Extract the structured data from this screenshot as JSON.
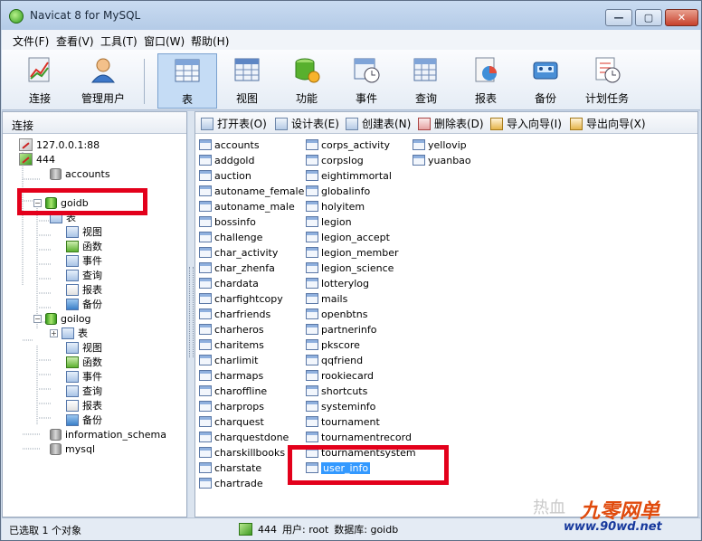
{
  "window": {
    "title": "Navicat 8 for MySQL",
    "min_glyph": "—",
    "max_glyph": "▢",
    "close_glyph": "✕"
  },
  "menu": [
    "文件(F)",
    "查看(V)",
    "工具(T)",
    "窗口(W)",
    "帮助(H)"
  ],
  "toolbar": [
    {
      "label": "连接",
      "icon": "connection-icon"
    },
    {
      "label": "管理用户",
      "icon": "user-icon"
    },
    {
      "label": "表",
      "icon": "table-icon",
      "active": true
    },
    {
      "label": "视图",
      "icon": "view-icon"
    },
    {
      "label": "功能",
      "icon": "function-icon"
    },
    {
      "label": "事件",
      "icon": "event-icon"
    },
    {
      "label": "查询",
      "icon": "query-icon"
    },
    {
      "label": "报表",
      "icon": "report-icon"
    },
    {
      "label": "备份",
      "icon": "backup-icon"
    },
    {
      "label": "计划任务",
      "icon": "schedule-icon"
    }
  ],
  "left_panel": {
    "header": "连接",
    "tree": [
      {
        "label": "127.0.0.1:88",
        "icon": "host-icon"
      },
      {
        "label": "444",
        "icon": "host-icon"
      },
      {
        "label": "accounts",
        "icon": "database-icon"
      },
      {
        "label": "goidb",
        "icon": "database-open-icon"
      },
      {
        "label": "表",
        "icon": "table-icon"
      },
      {
        "label": "视图",
        "icon": "view-icon"
      },
      {
        "label": "函数",
        "icon": "function-icon"
      },
      {
        "label": "事件",
        "icon": "event-icon"
      },
      {
        "label": "查询",
        "icon": "query-icon"
      },
      {
        "label": "报表",
        "icon": "report-icon"
      },
      {
        "label": "备份",
        "icon": "backup-icon"
      },
      {
        "label": "goilog",
        "icon": "database-open-icon"
      },
      {
        "label": "表",
        "icon": "table-icon"
      },
      {
        "label": "视图",
        "icon": "view-icon"
      },
      {
        "label": "函数",
        "icon": "function-icon"
      },
      {
        "label": "事件",
        "icon": "event-icon"
      },
      {
        "label": "查询",
        "icon": "query-icon"
      },
      {
        "label": "报表",
        "icon": "report-icon"
      },
      {
        "label": "备份",
        "icon": "backup-icon"
      },
      {
        "label": "information_schema",
        "icon": "database-icon"
      },
      {
        "label": "mysql",
        "icon": "database-icon"
      }
    ]
  },
  "object_toolbar": [
    "打开表(O)",
    "设计表(E)",
    "创建表(N)",
    "删除表(D)",
    "导入向导(I)",
    "导出向导(X)"
  ],
  "tables": {
    "column1": [
      "accounts",
      "addgold",
      "auction",
      "autoname_female",
      "autoname_male",
      "bossinfo",
      "challenge",
      "char_activity",
      "char_zhenfa",
      "chardata",
      "charfightcopy",
      "charfriends",
      "charheros",
      "charitems",
      "charlimit",
      "charmaps",
      "charoffline",
      "charprops",
      "charquest",
      "charquestdone",
      "charskillbooks",
      "charstate",
      "chartrade"
    ],
    "column2": [
      "corps_activity",
      "corpslog",
      "eightimmortal",
      "globalinfo",
      "holyitem",
      "legion",
      "legion_accept",
      "legion_member",
      "legion_science",
      "lotterylog",
      "mails",
      "openbtns",
      "partnerinfo",
      "pkscore",
      "qqfriend",
      "rookiecard",
      "shortcuts",
      "systeminfo",
      "tournament",
      "tournamentrecord",
      "tournamentsystem",
      "user_info"
    ],
    "column3": [
      "yellovip",
      "yuanbao"
    ],
    "selected": "user_info"
  },
  "status": {
    "left": "已选取 1 个对象",
    "connection": "444",
    "user": "用户: root",
    "database": "数据库: goidb"
  },
  "watermark": {
    "faint": "热血",
    "brand": "九零网单",
    "url": "www.90wd.net"
  },
  "colors": {
    "highlight": "#e3001b",
    "selection": "#3399ff"
  }
}
